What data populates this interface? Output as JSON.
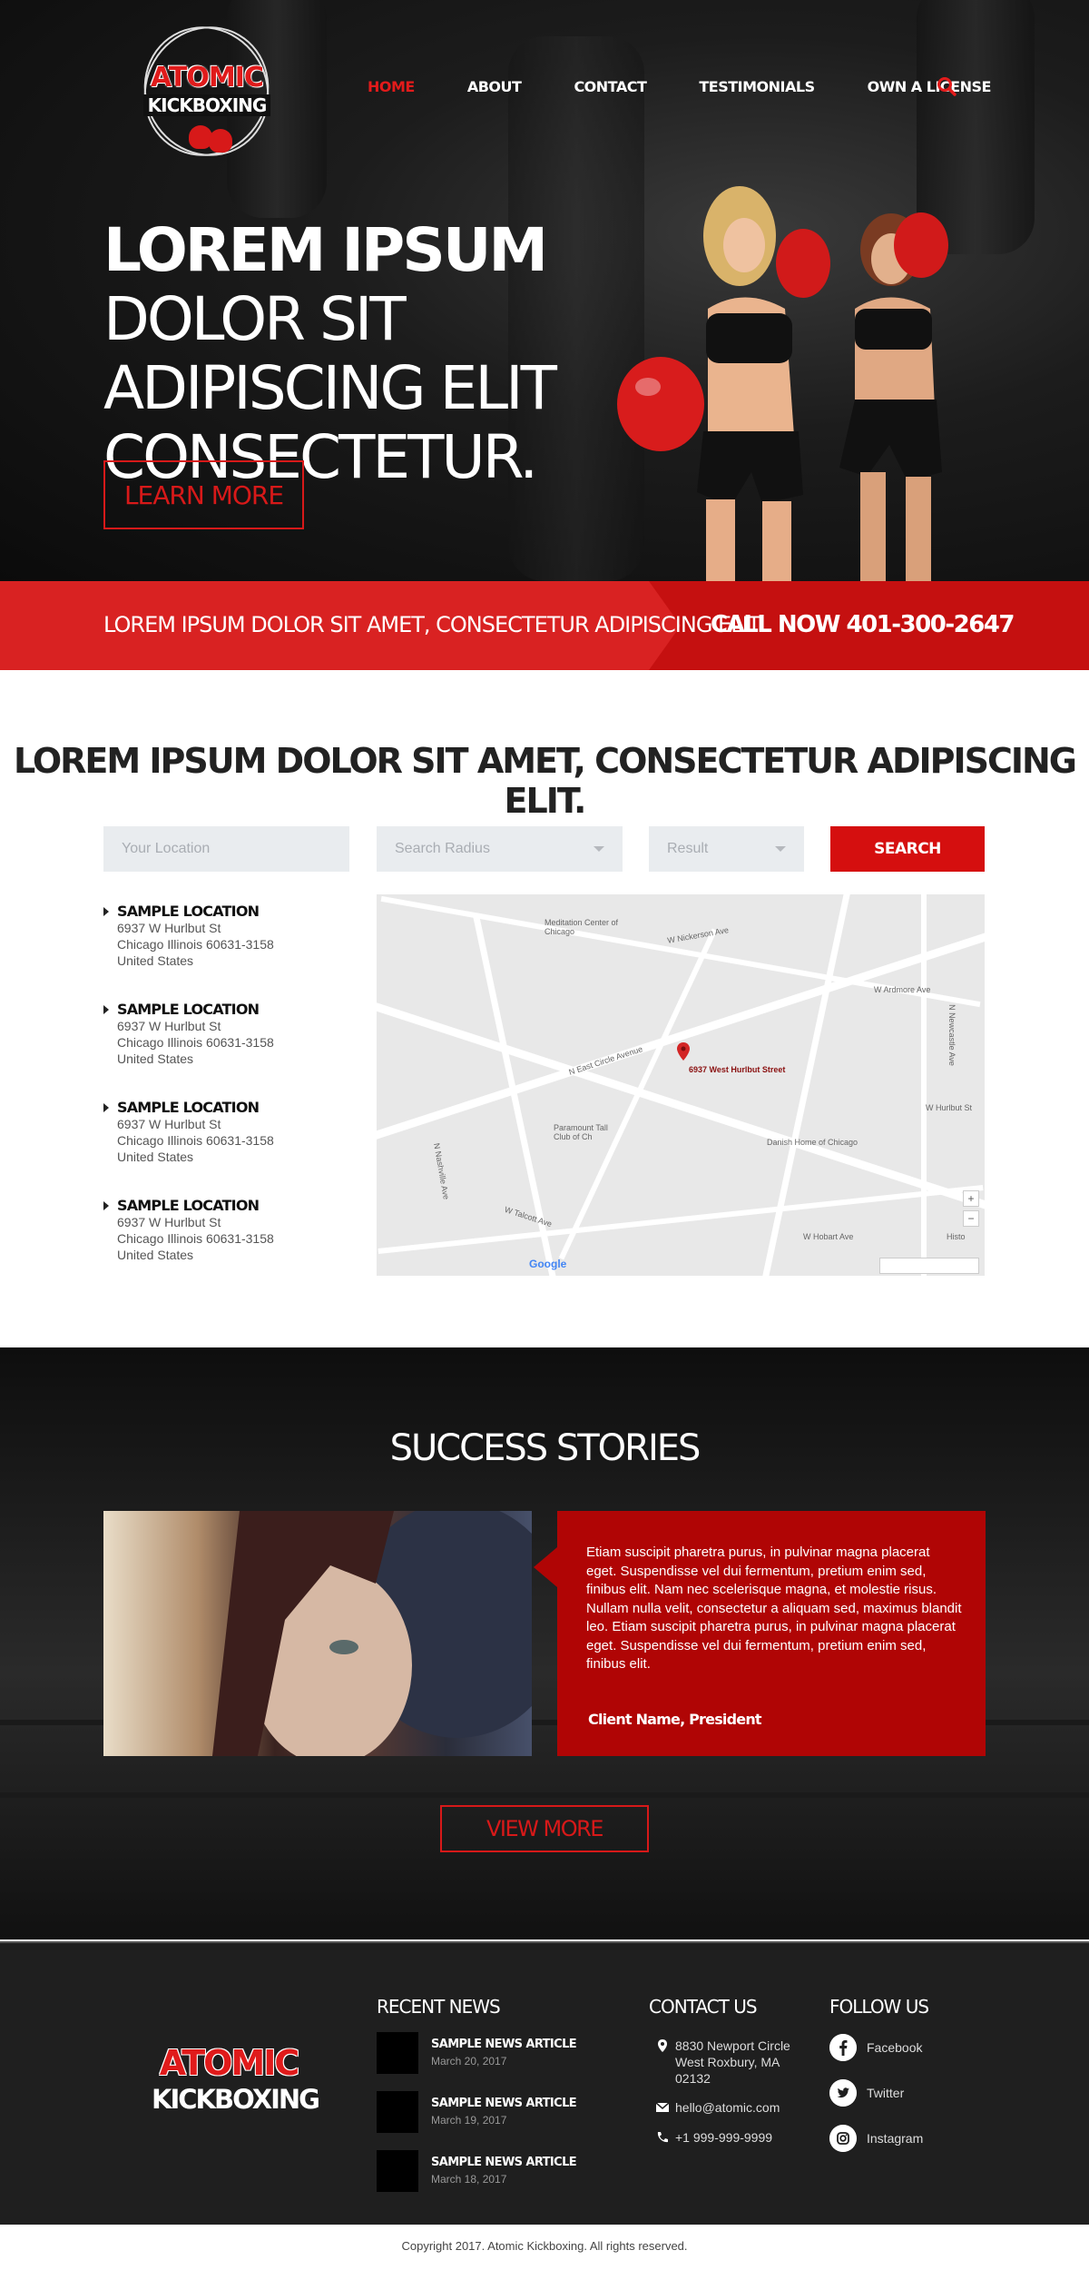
{
  "brand": {
    "logo_line1": "ATOMIC",
    "logo_line2": "KICKBOXING"
  },
  "nav": {
    "items": [
      {
        "label": "HOME",
        "active": true
      },
      {
        "label": "ABOUT",
        "active": false
      },
      {
        "label": "CONTACT",
        "active": false
      },
      {
        "label": "TESTIMONIALS",
        "active": false
      },
      {
        "label": "OWN A LICENSE",
        "active": false
      }
    ],
    "search_icon": "search-icon"
  },
  "hero": {
    "headline_bold": "LOREM IPSUM",
    "headline_rest": " DOLOR SIT ADIPISCING ELIT CONSECTETUR.",
    "button": "LEARN MORE"
  },
  "cta": {
    "message": "LOREM IPSUM DOLOR SIT AMET, CONSECTETUR ADIPISCING ELIT",
    "call": "CALL NOW 401-300-2647"
  },
  "locator": {
    "title": "LOREM IPSUM DOLOR SIT AMET, CONSECTETUR ADIPISCING ELIT.",
    "location_placeholder": "Your Location",
    "radius_placeholder": "Search Radius",
    "result_placeholder": "Result",
    "search_button": "SEARCH",
    "locations": [
      {
        "name": "SAMPLE LOCATION",
        "street": "6937 W Hurlbut St",
        "city": "Chicago Illinois 60631-3158",
        "country": "United States"
      },
      {
        "name": "SAMPLE LOCATION",
        "street": "6937 W Hurlbut St",
        "city": "Chicago Illinois 60631-3158",
        "country": "United States"
      },
      {
        "name": "SAMPLE LOCATION",
        "street": "6937 W Hurlbut St",
        "city": "Chicago Illinois 60631-3158",
        "country": "United States"
      },
      {
        "name": "SAMPLE LOCATION",
        "street": "6937 W Hurlbut St",
        "city": "Chicago Illinois 60631-3158",
        "country": "United States"
      }
    ],
    "map": {
      "pin_label": "6937 West Hurlbut Street",
      "poi_1": "Meditation Center of Chicago",
      "poi_2": "Paramount Tall Club of Ch",
      "poi_3": "Danish Home of Chicago",
      "attribution": "Google",
      "street_1": "W Ardmore Ave",
      "street_2": "N East Circle Avenue",
      "street_3": "W Hurlbut St",
      "street_4": "W Talcott Ave",
      "street_5": "W Hobart Ave",
      "street_6": "N Newcastle Ave",
      "street_7": "W Nickerson Ave",
      "street_8": "N Nashville Ave",
      "street_9": "Histo",
      "zoom_in": "+",
      "zoom_out": "−"
    }
  },
  "success": {
    "title": "SUCCESS STORIES",
    "quote": "Etiam suscipit pharetra purus, in pulvinar magna placerat eget. Suspendisse vel dui fermentum, pretium enim sed, finibus elit. Nam nec scelerisque magna, et molestie risus. Nullam nulla velit, consectetur a aliquam sed, maximus blandit leo. Etiam suscipit pharetra purus, in pulvinar magna placerat eget. Suspendisse vel dui fermentum, pretium enim sed, finibus elit.",
    "client": "Client Name, President",
    "button": "VIEW MORE"
  },
  "footer": {
    "recent_news_title": "RECENT NEWS",
    "news": [
      {
        "title": "SAMPLE NEWS ARTICLE",
        "date": "March 20, 2017"
      },
      {
        "title": "SAMPLE NEWS ARTICLE",
        "date": "March 19, 2017"
      },
      {
        "title": "SAMPLE NEWS ARTICLE",
        "date": "March 18, 2017"
      }
    ],
    "contact_title": "CONTACT US",
    "address_1": "8830 Newport Circle",
    "address_2": "West Roxbury, MA",
    "address_3": "02132",
    "email": "hello@atomic.com",
    "phone": "+1 999-999-9999",
    "follow_title": "FOLLOW US",
    "social": [
      {
        "label": "Facebook",
        "icon": "facebook-icon"
      },
      {
        "label": "Twitter",
        "icon": "twitter-icon"
      },
      {
        "label": "Instagram",
        "icon": "instagram-icon"
      }
    ]
  },
  "copyright": "Copyright 2017. Atomic Kickboxing. All rights reserved.",
  "colors": {
    "accent": "#d71919",
    "dark": "#1f1f1f",
    "cta": "#c51010"
  }
}
